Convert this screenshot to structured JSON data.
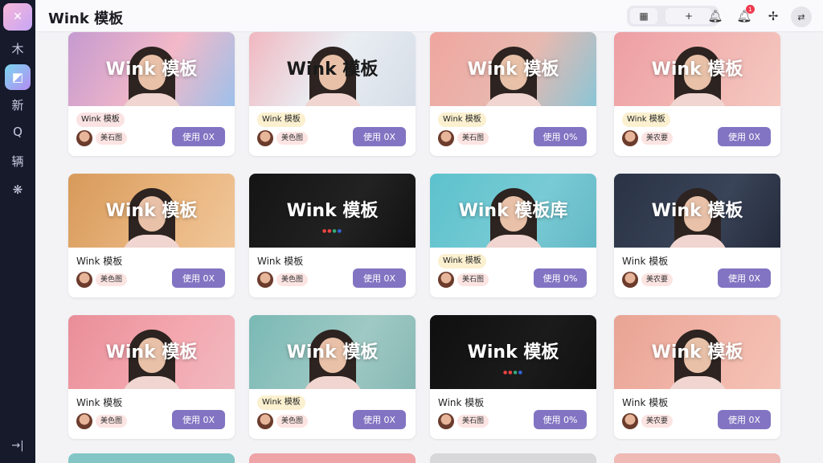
{
  "app": {
    "title": "Wink 模板",
    "logo_icon": "x-logo-icon"
  },
  "sidebar": {
    "items": [
      {
        "label": "木",
        "icon": "home-icon"
      },
      {
        "label": "◩",
        "icon": "template-icon",
        "active": true
      },
      {
        "label": "新",
        "icon": "new-icon"
      },
      {
        "label": "Q",
        "icon": "search-icon"
      },
      {
        "label": "辆",
        "icon": "vehicle-icon"
      },
      {
        "label": "❋",
        "icon": "settings-icon"
      }
    ],
    "bottom_icon": "collapse-icon"
  },
  "header": {
    "grid_btn": "▦",
    "add_btn": "+",
    "notification_count": "1"
  },
  "cards": [
    {
      "overlay": "Wink 模板",
      "tag": "Wink 模板",
      "tag_bg": "#fbe3e3",
      "author": "美石图",
      "button": "使用 0X",
      "bg": "linear-gradient(120deg,#c59ad0,#f3b9c8 55%,#9dc0ea)",
      "overlay_dark": false
    },
    {
      "overlay": "Wink 模板",
      "tag": "Wink 模板",
      "tag_bg": "#fbf0cf",
      "author": "美色图",
      "button": "使用 0X",
      "bg": "linear-gradient(120deg,#f1b7c0,#e9eef3 50%,#d7dde7)",
      "overlay_dark": true
    },
    {
      "overlay": "Wink 模板",
      "tag": "Wink 模板",
      "tag_bg": "#fbf0cf",
      "author": "美石图",
      "button": "使用 0%",
      "bg": "linear-gradient(120deg,#f0a69f,#e7b9b0 55%,#8bc5d6)",
      "overlay_dark": false
    },
    {
      "overlay": "Wink 模板",
      "tag": "Wink 模板",
      "tag_bg": "#fbf0cf",
      "author": "美农要",
      "button": "使用 0X",
      "bg": "linear-gradient(120deg,#ee9ea3,#f2b8b4 60%,#f5c8c0)",
      "overlay_dark": false
    },
    {
      "overlay": "Wink 模板",
      "tag": "Wink 模板",
      "tag_bg": "",
      "author": "美色图",
      "button": "使用 0X",
      "bg": "linear-gradient(120deg,#d79a5a,#eab680 60%,#f0c79a)",
      "overlay_dark": false
    },
    {
      "overlay": "Wink 模板",
      "tag": "Wink 模板",
      "tag_bg": "",
      "author": "美色图",
      "button": "使用 0X",
      "bg": "linear-gradient(120deg,#141414,#222 60%,#111)",
      "overlay_dark": false
    },
    {
      "overlay": "Wink 模板库",
      "tag": "Wink 模板",
      "tag_bg": "#fbf0cf",
      "author": "美石图",
      "button": "使用 0%",
      "bg": "linear-gradient(120deg,#5cc2cd,#79cbd4 60%,#64b8c6)",
      "overlay_dark": false
    },
    {
      "overlay": "Wink 模板",
      "tag": "Wink 模板",
      "tag_bg": "",
      "author": "美农要",
      "button": "使用 0X",
      "bg": "linear-gradient(120deg,#2a3346,#3a4458 60%,#232a3b)",
      "overlay_dark": false
    },
    {
      "overlay": "Wink 模板",
      "tag": "Wink 模板",
      "tag_bg": "",
      "author": "美色图",
      "button": "使用 0X",
      "bg": "linear-gradient(120deg,#e98e99,#f4a8b0 60%,#f0b9bf)",
      "overlay_dark": false
    },
    {
      "overlay": "Wink 模板",
      "tag": "Wink 模板",
      "tag_bg": "#fbf0cf",
      "author": "美色图",
      "button": "使用 0X",
      "bg": "linear-gradient(120deg,#7ab9b5,#9fc9c4 60%,#87b8b4)",
      "overlay_dark": false
    },
    {
      "overlay": "Wink 模板",
      "tag": "Wink 模板",
      "tag_bg": "",
      "author": "美石图",
      "button": "使用 0%",
      "bg": "linear-gradient(120deg,#0f0f0f,#1b1b1b 60%,#101010)",
      "overlay_dark": false
    },
    {
      "overlay": "Wink 模板",
      "tag": "Wink 模板",
      "tag_bg": "",
      "author": "美农要",
      "button": "使用 0X",
      "bg": "linear-gradient(120deg,#e8a394,#f2b7aa 60%,#f4c3b6)",
      "overlay_dark": false
    }
  ],
  "peek_colors": [
    "#84c6c6",
    "#efa4a8",
    "#d8d8da",
    "#efb9b5"
  ]
}
